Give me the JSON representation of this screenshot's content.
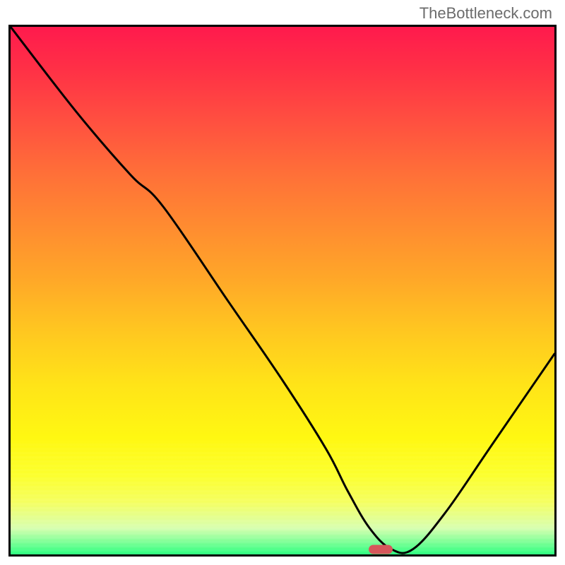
{
  "watermark": "TheBottleneck.com",
  "chart_data": {
    "type": "line",
    "title": "",
    "xlabel": "",
    "ylabel": "",
    "xlim": [
      0,
      100
    ],
    "ylim": [
      0,
      100
    ],
    "grid": false,
    "background": "rainbow-gradient-red-to-green",
    "series": [
      {
        "name": "bottleneck-curve",
        "x": [
          0,
          12,
          22,
          28,
          40,
          50,
          58,
          62,
          66,
          70,
          74,
          80,
          88,
          96,
          100
        ],
        "values": [
          100,
          84,
          72,
          66,
          48,
          33,
          20,
          12,
          5,
          1,
          1,
          8,
          20,
          32,
          38
        ]
      }
    ],
    "annotations": [
      {
        "name": "optimal-marker",
        "x": 68,
        "y": 1,
        "shape": "pill",
        "color": "#d6575b"
      }
    ]
  },
  "colors": {
    "border": "#000000",
    "watermark": "#6b6b6b",
    "marker": "#d6575b"
  }
}
